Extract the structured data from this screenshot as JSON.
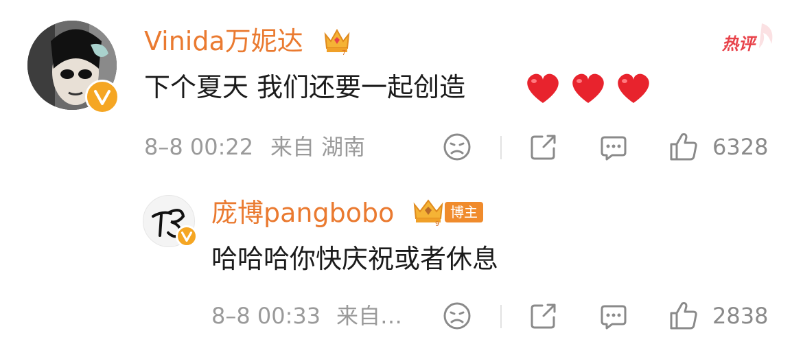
{
  "comment": {
    "username": "Vinida万妮达",
    "tag": "热评",
    "text": "下个夏天 我们还要一起创造",
    "hearts": "❤️❤️❤️",
    "time": "8–8 00:22",
    "location": "来自 湖南",
    "likes": "6328"
  },
  "reply": {
    "username": "庞博pangbobo",
    "author_badge": "博主",
    "text": "哈哈哈你快庆祝或者休息",
    "time": "8–8 00:33",
    "location": "来自…",
    "likes": "2838"
  },
  "icons": [
    "crown-icon",
    "verified-icon",
    "dislike-face-icon",
    "share-icon",
    "comment-icon",
    "like-thumb-icon",
    "heart-icon"
  ]
}
